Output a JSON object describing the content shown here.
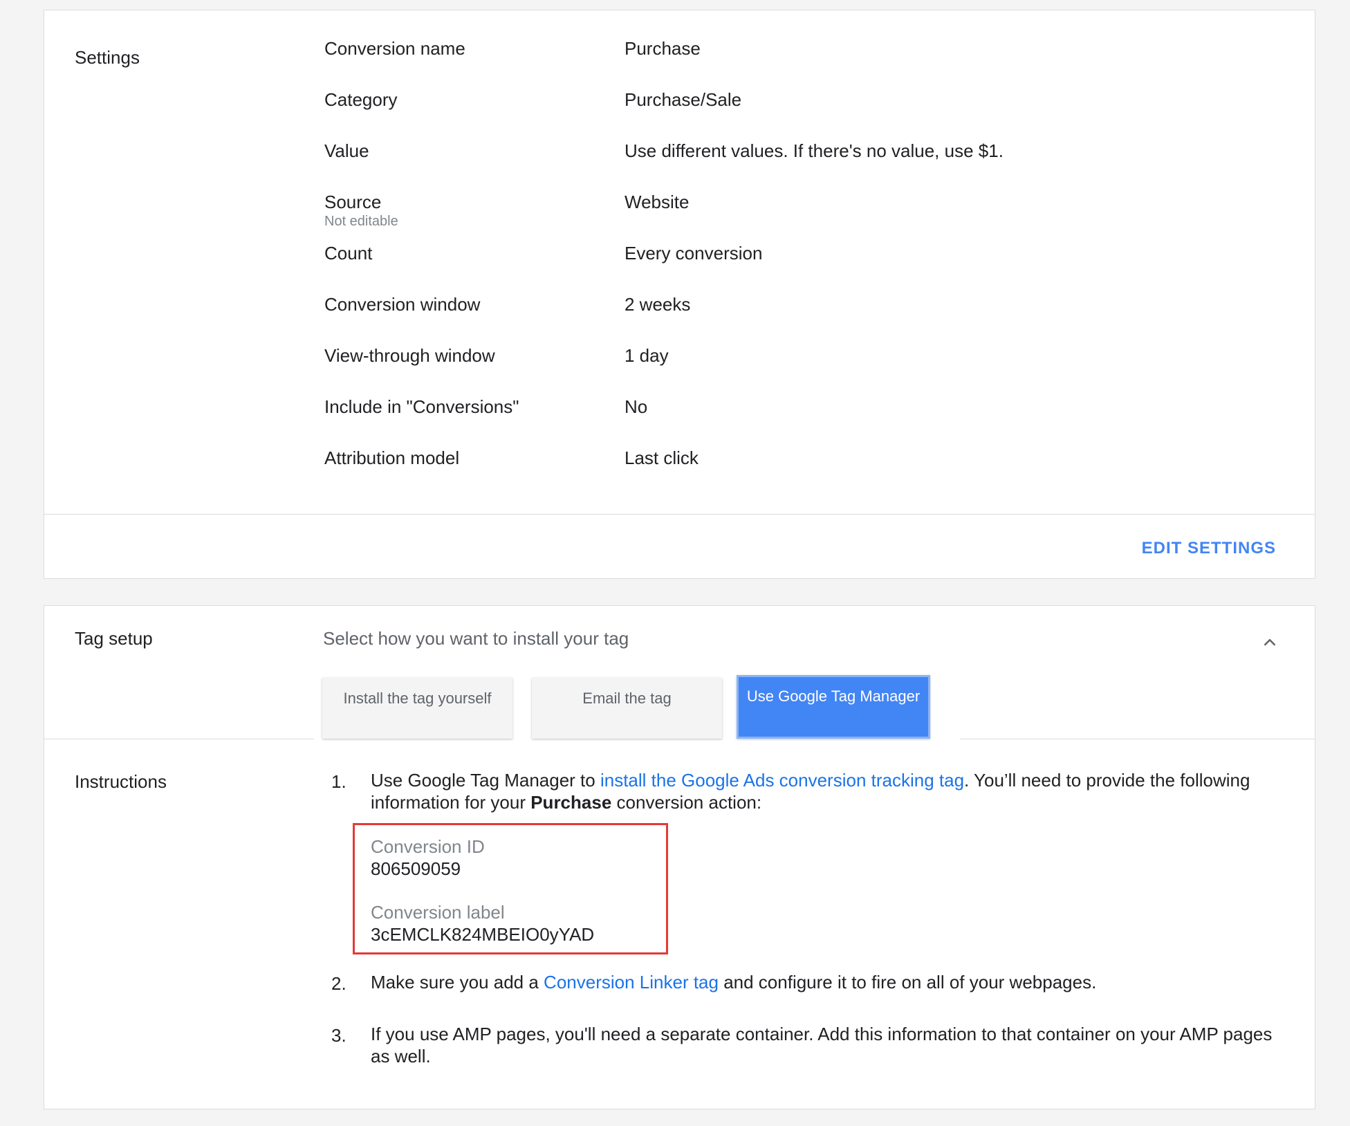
{
  "settings": {
    "title": "Settings",
    "rows": [
      {
        "label": "Conversion name",
        "value": "Purchase"
      },
      {
        "label": "Category",
        "value": "Purchase/Sale"
      },
      {
        "label": "Value",
        "value": "Use different values. If there's no value, use $1."
      },
      {
        "label": "Source",
        "sublabel": "Not editable",
        "value": "Website"
      },
      {
        "label": "Count",
        "value": "Every conversion"
      },
      {
        "label": "Conversion window",
        "value": "2 weeks"
      },
      {
        "label": "View-through window",
        "value": "1 day"
      },
      {
        "label": "Include in \"Conversions\"",
        "value": "No"
      },
      {
        "label": "Attribution model",
        "value": "Last click"
      }
    ],
    "edit_label": "EDIT SETTINGS"
  },
  "tag_setup": {
    "title": "Tag setup",
    "prompt": "Select how you want to install your tag",
    "options": [
      {
        "label": "Install the tag yourself",
        "selected": false
      },
      {
        "label": "Email the tag",
        "selected": false
      },
      {
        "label": "Use Google Tag Manager",
        "selected": true
      }
    ]
  },
  "instructions": {
    "title": "Instructions",
    "steps": [
      {
        "num": "1.",
        "text_before": "Use Google Tag Manager to ",
        "link": "install the Google Ads conversion tracking tag",
        "text_after": ". You’ll need to provide the following information for your ",
        "bold": "Purchase",
        "text_end": " conversion action:"
      },
      {
        "num": "2.",
        "text_before": "Make sure you add a ",
        "link": "Conversion Linker tag",
        "text_after": " and configure it to fire on all of your webpages."
      },
      {
        "num": "3.",
        "text": "If you use AMP pages, you'll need a separate container. Add this information to that container on your AMP pages as well."
      }
    ],
    "conversion_id_label": "Conversion ID",
    "conversion_id": "806509059",
    "conversion_label_label": "Conversion label",
    "conversion_label": "3cEMCLK824MBEIO0yYAD"
  },
  "colors": {
    "accent": "#4285f4",
    "link": "#1a73e8",
    "highlight_box": "#e53935"
  }
}
